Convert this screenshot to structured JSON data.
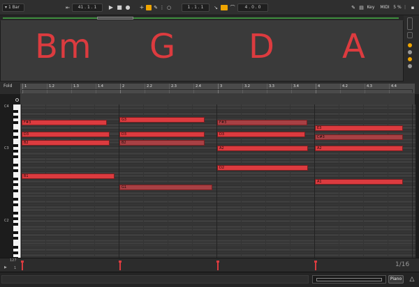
{
  "transport": {
    "launch_quant": "1 Bar",
    "position": "41 . 1 . 1",
    "loop_start": "1 . 1 . 1",
    "loop_length": "4 . 0 . 0",
    "key_label": "Key",
    "midi_label": "MIDI",
    "cpu_label": "5 %",
    "colors": {
      "accent": "#f0a500",
      "record": "#e0e0e0"
    }
  },
  "clip": {
    "chords": [
      "Bm",
      "G",
      "D",
      "A"
    ],
    "chord_color": "#dc3b3f"
  },
  "editor": {
    "fold_label": "Fold",
    "ruler_ticks": [
      "1",
      "1.2",
      "1.3",
      "1.4",
      "2",
      "2.2",
      "2.3",
      "2.4",
      "3",
      "3.2",
      "3.3",
      "3.4",
      "4",
      "4.2",
      "4.3",
      "4.4"
    ],
    "pitch_labels": [
      "C4",
      "C3",
      "C2"
    ],
    "notes": [
      {
        "label": "F#3",
        "beat": 0.0,
        "len": 0.9,
        "pitch": 66,
        "dim": false
      },
      {
        "label": "D3",
        "beat": 0.0,
        "len": 0.93,
        "pitch": 62,
        "dim": false
      },
      {
        "label": "B2",
        "beat": 0.0,
        "len": 0.93,
        "pitch": 59,
        "dim": false
      },
      {
        "label": "B1",
        "beat": 0.0,
        "len": 0.98,
        "pitch": 47,
        "dim": false
      },
      {
        "label": "G3",
        "beat": 1.0,
        "len": 0.9,
        "pitch": 67,
        "dim": false
      },
      {
        "label": "D3",
        "beat": 1.0,
        "len": 0.9,
        "pitch": 62,
        "dim": false
      },
      {
        "label": "B2",
        "beat": 1.0,
        "len": 0.9,
        "pitch": 59,
        "dim": true
      },
      {
        "label": "G1",
        "beat": 1.0,
        "len": 0.98,
        "pitch": 43,
        "dim": true
      },
      {
        "label": "F#3",
        "beat": 2.0,
        "len": 0.95,
        "pitch": 66,
        "dim": true
      },
      {
        "label": "D3",
        "beat": 2.0,
        "len": 0.93,
        "pitch": 62,
        "dim": false
      },
      {
        "label": "A2",
        "beat": 2.0,
        "len": 0.96,
        "pitch": 57,
        "dim": false
      },
      {
        "label": "D2",
        "beat": 2.0,
        "len": 0.96,
        "pitch": 50,
        "dim": false
      },
      {
        "label": "E3",
        "beat": 3.0,
        "len": 0.93,
        "pitch": 64,
        "dim": false
      },
      {
        "label": "C#3",
        "beat": 3.0,
        "len": 0.93,
        "pitch": 61,
        "dim": true
      },
      {
        "label": "A2",
        "beat": 3.0,
        "len": 0.93,
        "pitch": 57,
        "dim": false
      },
      {
        "label": "A1",
        "beat": 3.0,
        "len": 0.93,
        "pitch": 45,
        "dim": false
      }
    ],
    "velocity_max": "127",
    "velocity_min": "1",
    "quantize_label": "1/16",
    "velocities": [
      1.0,
      1.0,
      1.0,
      1.0
    ]
  },
  "bottom": {
    "view_label": "Piano"
  }
}
